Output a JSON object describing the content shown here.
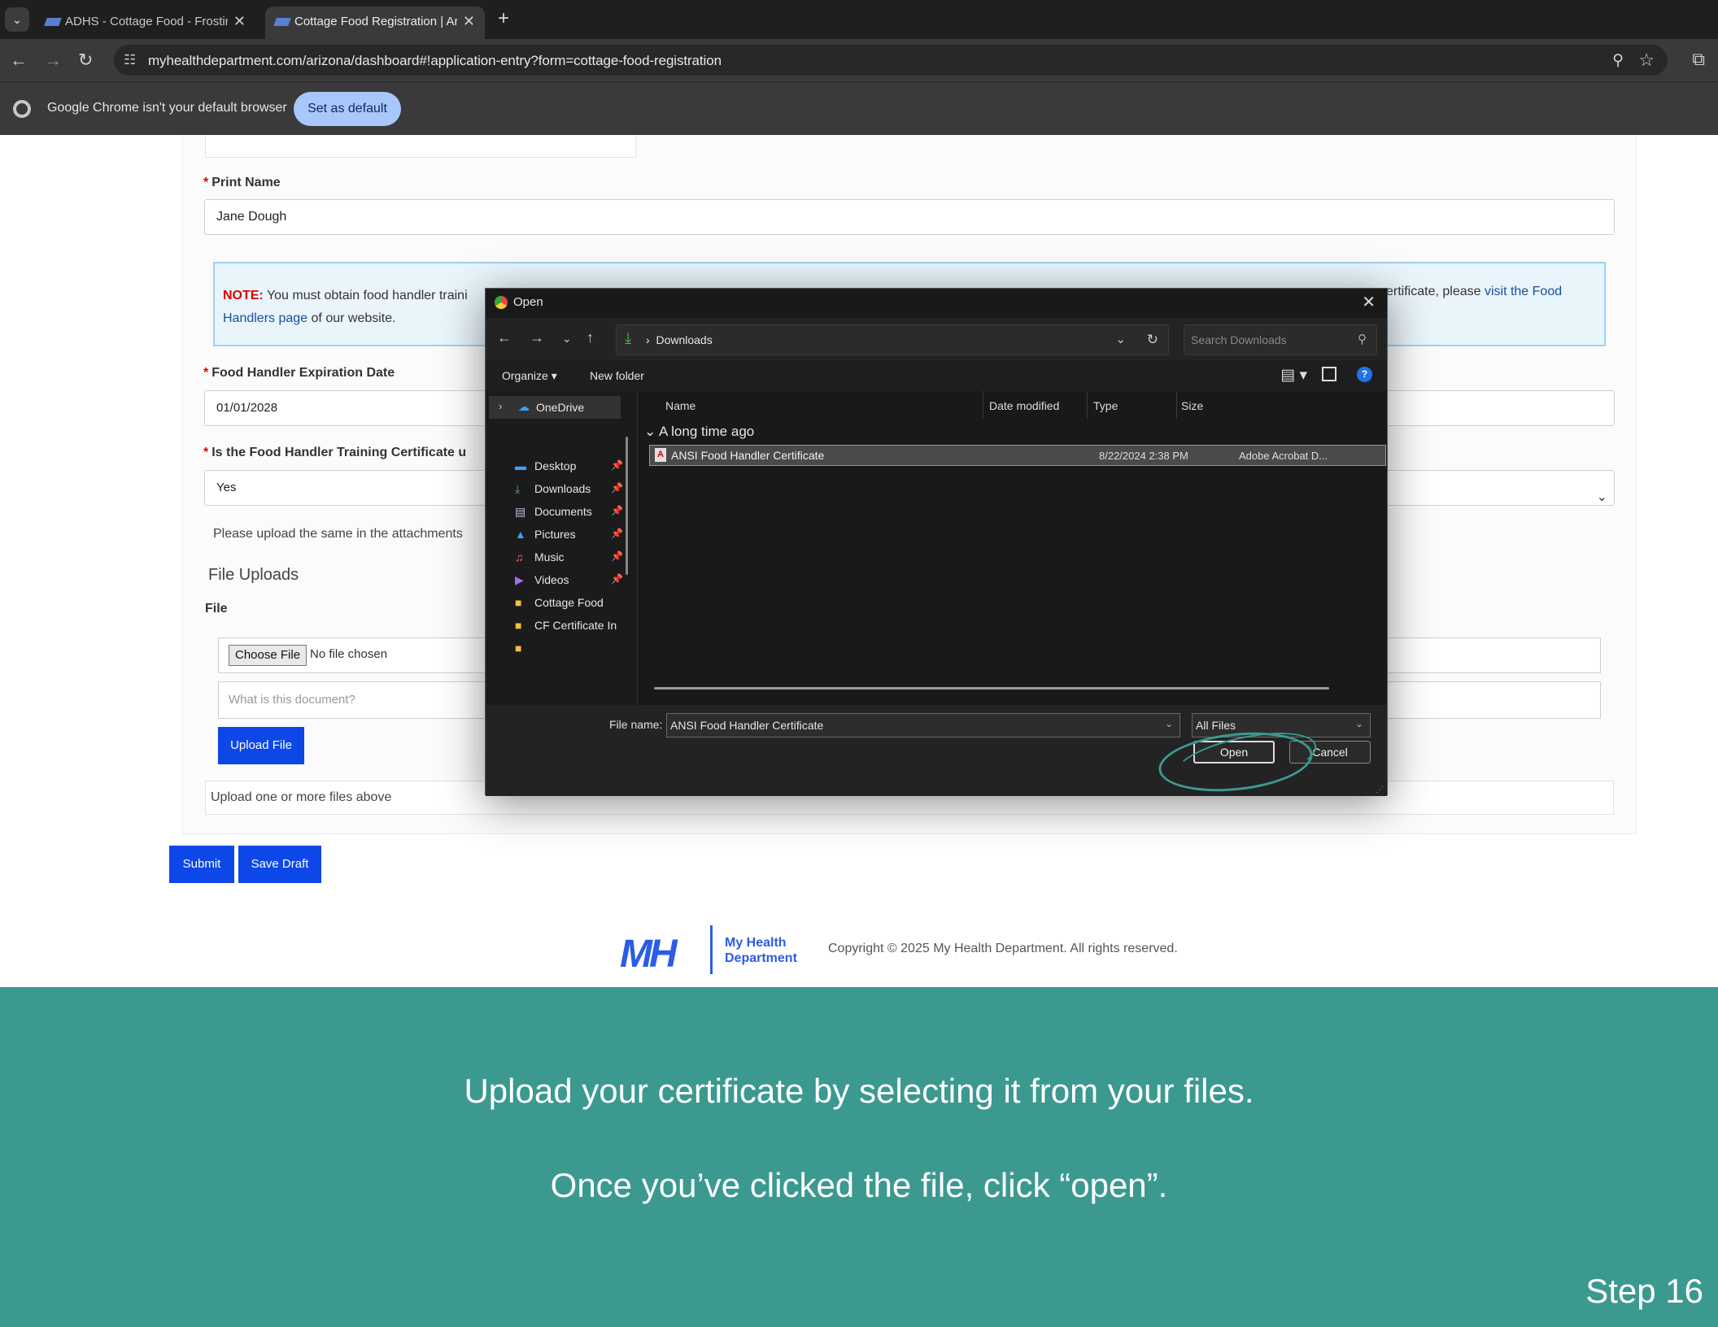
{
  "browser": {
    "tabs": [
      {
        "title": "ADHS - Cottage Food - Frosting",
        "active": false
      },
      {
        "title": "Cottage Food Registration | Ari",
        "active": true
      }
    ],
    "url": "myhealthdepartment.com/arizona/dashboard#!application-entry?form=cottage-food-registration",
    "infobar_text": "Google Chrome isn't your default browser",
    "infobar_button": "Set as default"
  },
  "form": {
    "print_name_label": "Print Name",
    "print_name_value": "Jane Dough",
    "note_prefix": "NOTE:",
    "note_text_left": " You must obtain food handler traini",
    "note_link_2": "Handlers page",
    "note_text_2": " of our website.",
    "note_text_right": "ertificate, please ",
    "note_link_right": "visit the Food",
    "expiration_label": "Food Handler Expiration Date",
    "expiration_value": "01/01/2028",
    "training_question": "Is the Food Handler Training Certificate u",
    "training_value": "Yes",
    "upload_hint_text": "Please upload the same in the attachments",
    "file_uploads_title": "File Uploads",
    "file_label": "File",
    "choose_file": "Choose File",
    "no_file": "No file chosen",
    "document_placeholder": "What is this document?",
    "upload_button": "Upload File",
    "upload_more": "Upload one or more files above",
    "submit": "Submit",
    "save_draft": "Save Draft"
  },
  "footer": {
    "logo_text": "MH",
    "brand_line1": "My Health",
    "brand_line2": "Department",
    "copyright": "Copyright © 2025 My Health Department. All rights reserved."
  },
  "dialog": {
    "title": "Open",
    "path": "Downloads",
    "search_placeholder": "Search Downloads",
    "organize": "Organize ▾",
    "new_folder": "New folder",
    "sidebar": [
      {
        "label": "OneDrive"
      },
      {
        "label": "Desktop",
        "pinned": true
      },
      {
        "label": "Downloads",
        "pinned": true
      },
      {
        "label": "Documents",
        "pinned": true
      },
      {
        "label": "Pictures",
        "pinned": true
      },
      {
        "label": "Music",
        "pinned": true
      },
      {
        "label": "Videos",
        "pinned": true
      },
      {
        "label": "Cottage Food"
      },
      {
        "label": "CF Certificate In"
      }
    ],
    "columns": [
      "Name",
      "Date modified",
      "Type",
      "Size"
    ],
    "group": "A long time ago",
    "file": {
      "name": "ANSI Food Handler Certificate",
      "date": "8/22/2024 2:38 PM",
      "type": "Adobe Acrobat D..."
    },
    "file_name_label": "File name:",
    "file_name_value": "ANSI Food Handler Certificate",
    "file_type": "All Files",
    "open_button": "Open",
    "cancel_button": "Cancel"
  },
  "instructions": {
    "line1": "Upload your certificate by selecting it from your files.",
    "line2": "Once you’ve clicked the file, click “open”.",
    "step": "Step 16"
  },
  "colors": {
    "teal_panel": "#3b9990",
    "primary_button": "#0d47e8",
    "brand_blue": "#2b5ce6"
  }
}
